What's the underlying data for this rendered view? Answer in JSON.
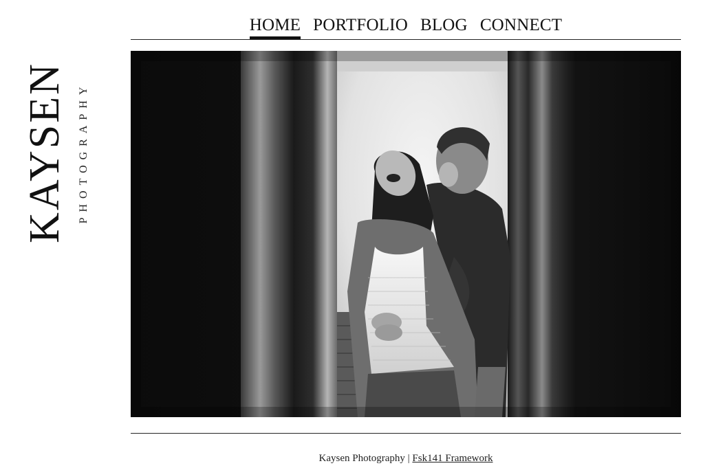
{
  "logo": {
    "main": "KAYSEN",
    "sub": "PHOTOGRAPHY"
  },
  "nav": {
    "items": [
      {
        "label": "HOME",
        "active": true
      },
      {
        "label": "PORTFOLIO",
        "active": false
      },
      {
        "label": "BLOG",
        "active": false
      },
      {
        "label": "CONNECT",
        "active": false
      }
    ]
  },
  "footer": {
    "site_name": "Kaysen Photography",
    "separator": "|",
    "framework_link": "Fsk141 Framework"
  },
  "colors": {
    "text": "#111111",
    "background": "#ffffff",
    "rule": "#222222"
  }
}
